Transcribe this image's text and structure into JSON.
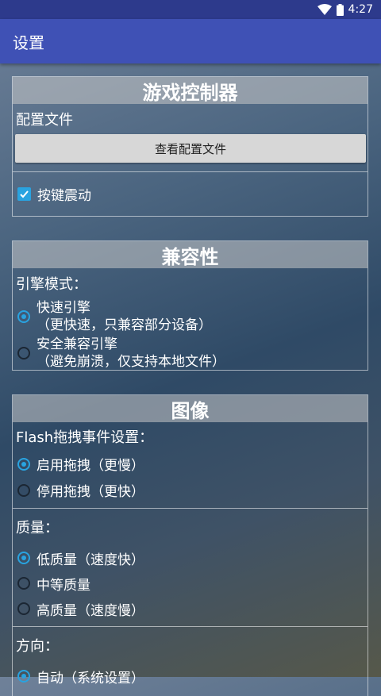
{
  "status_bar": {
    "time": "4:27",
    "icons": [
      "wifi-icon",
      "battery-icon"
    ]
  },
  "app_bar": {
    "title": "设置"
  },
  "game_controller": {
    "header": "游戏控制器",
    "config_label": "配置文件",
    "view_config_button": "查看配置文件",
    "vibration_label": "按键震动",
    "vibration_checked": true
  },
  "compatibility": {
    "header": "兼容性",
    "engine_mode_label": "引擎模式：",
    "options": [
      {
        "line1": "快速引擎",
        "line2": "（更快速，只兼容部分设备）",
        "selected": true
      },
      {
        "line1": "安全兼容引擎",
        "line2": "（避免崩溃，仅支持本地文件）",
        "selected": false
      }
    ]
  },
  "image": {
    "header": "图像",
    "drag_label": "Flash拖拽事件设置：",
    "drag_options": [
      {
        "label": "启用拖拽（更慢）",
        "selected": true
      },
      {
        "label": "停用拖拽（更快）",
        "selected": false
      }
    ],
    "quality_label": "质量：",
    "quality_options": [
      {
        "label": "低质量（速度快）",
        "selected": true
      },
      {
        "label": "中等质量",
        "selected": false
      },
      {
        "label": "高质量（速度慢）",
        "selected": false
      }
    ],
    "orientation_label": "方向：",
    "orientation_options": [
      {
        "label": "自动（系统设置）",
        "selected": true
      }
    ]
  },
  "colors": {
    "accent": "#29a3e0",
    "app_bar": "#3f51b5",
    "status_bar": "#2d3a8c"
  }
}
